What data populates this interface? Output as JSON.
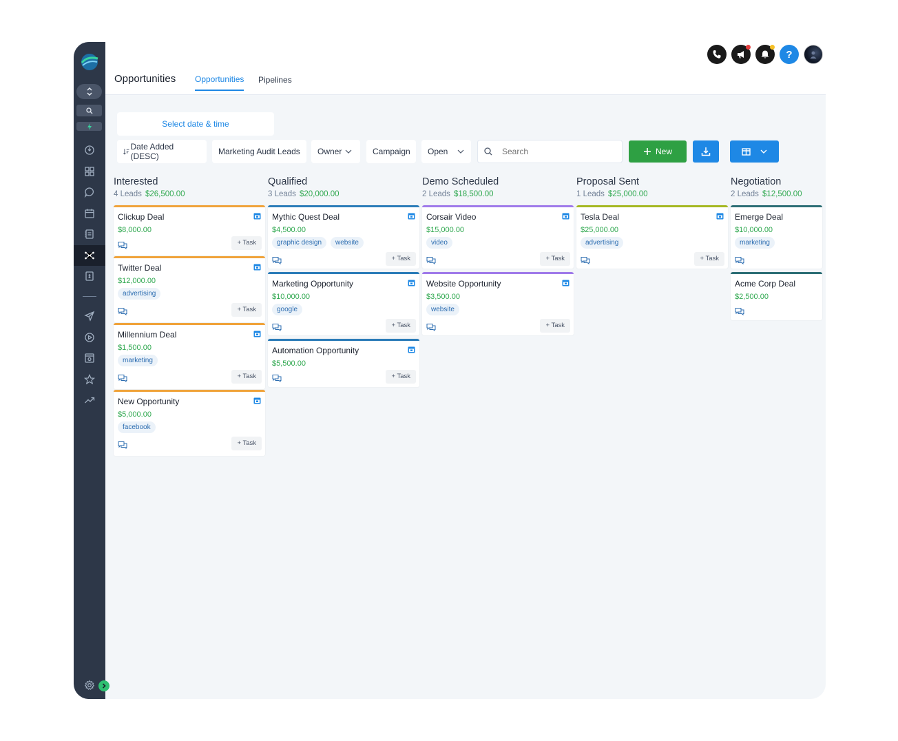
{
  "header": {
    "page_title": "Opportunities",
    "tabs": [
      {
        "label": "Opportunities",
        "active": true
      },
      {
        "label": "Pipelines",
        "active": false
      }
    ],
    "icons": [
      "phone-icon",
      "megaphone-icon",
      "bell-icon",
      "help-icon",
      "avatar"
    ]
  },
  "filters": {
    "date_picker": "Select date & time",
    "sort": "Date Added (DESC)",
    "pipeline": "Marketing Audit Leads",
    "owner": "Owner",
    "campaign": "Campaign",
    "status": "Open",
    "search_placeholder": "Search",
    "new_label": "New"
  },
  "colors": {
    "sidebar": "#2d3748",
    "accent": "#1e88e5",
    "new_button": "#2ea043",
    "amount": "#2fa84f"
  },
  "columns": [
    {
      "title": "Interested",
      "leads": "4 Leads",
      "amount": "$26,500.00",
      "cards": [
        {
          "name": "Clickup Deal",
          "value": "$8,000.00",
          "tags": []
        },
        {
          "name": "Twitter Deal",
          "value": "$12,000.00",
          "tags": [
            "advertising"
          ]
        },
        {
          "name": "Millennium Deal",
          "value": "$1,500.00",
          "tags": [
            "marketing"
          ]
        },
        {
          "name": "New Opportunity",
          "value": "$5,000.00",
          "tags": [
            "facebook"
          ]
        }
      ]
    },
    {
      "title": "Qualified",
      "leads": "3 Leads",
      "amount": "$20,000.00",
      "cards": [
        {
          "name": "Mythic Quest Deal",
          "value": "$4,500.00",
          "tags": [
            "graphic design",
            "website"
          ]
        },
        {
          "name": "Marketing Opportunity",
          "value": "$10,000.00",
          "tags": [
            "google"
          ]
        },
        {
          "name": "Automation Opportunity",
          "value": "$5,500.00",
          "tags": []
        }
      ]
    },
    {
      "title": "Demo Scheduled",
      "leads": "2 Leads",
      "amount": "$18,500.00",
      "cards": [
        {
          "name": "Corsair Video",
          "value": "$15,000.00",
          "tags": [
            "video"
          ]
        },
        {
          "name": "Website Opportunity",
          "value": "$3,500.00",
          "tags": [
            "website"
          ]
        }
      ]
    },
    {
      "title": "Proposal Sent",
      "leads": "1 Leads",
      "amount": "$25,000.00",
      "cards": [
        {
          "name": "Tesla Deal",
          "value": "$25,000.00",
          "tags": [
            "advertising"
          ]
        }
      ]
    },
    {
      "title": "Negotiation",
      "leads": "2 Leads",
      "amount": "$12,500.00",
      "cards": [
        {
          "name": "Emerge Deal",
          "value": "$10,000.00",
          "tags": [
            "marketing"
          ]
        },
        {
          "name": "Acme Corp Deal",
          "value": "$2,500.00",
          "tags": []
        }
      ]
    }
  ],
  "task_label": "+ Task"
}
